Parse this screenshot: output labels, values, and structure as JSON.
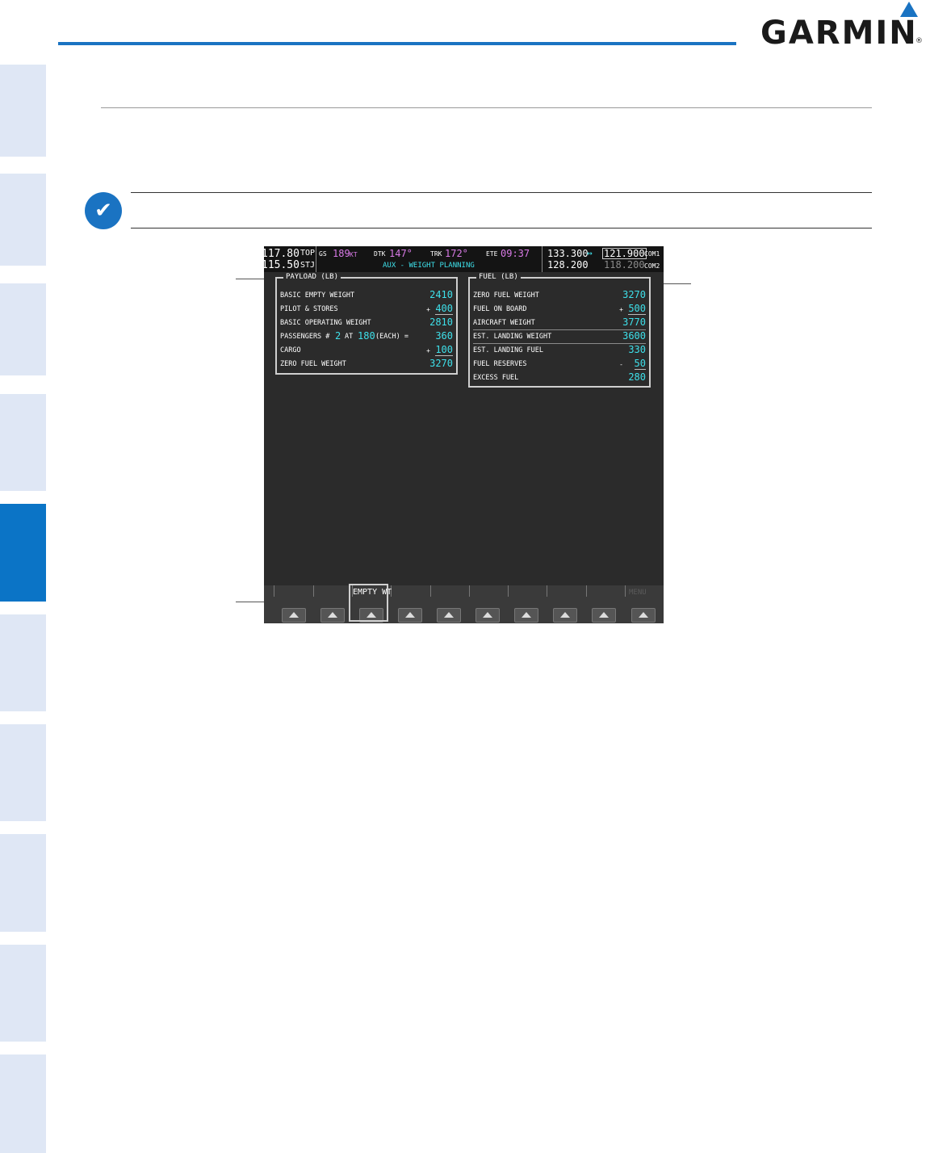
{
  "header": {
    "brand": "GARMIN",
    "registered": "®"
  },
  "note": {
    "icon": "checkmark-icon"
  },
  "display": {
    "topbar": {
      "nav1_active": "117.80",
      "nav1_standby": "115.50",
      "top_label": "TOP",
      "stj_label": "STJ",
      "gs_label": "GS",
      "gs_value": "189",
      "gs_unit": "KT",
      "dtk_label": "DTK",
      "dtk_value": "147°",
      "trk_label": "TRK",
      "trk_value": "172°",
      "ete_label": "ETE",
      "ete_value": "09:37",
      "page_title": "AUX - WEIGHT PLANNING",
      "com1_active": "133.300",
      "com1_swap": "↔",
      "com1_standby": "121.900",
      "com1_label": "COM1",
      "com2_active": "128.200",
      "com2_standby": "118.200",
      "com2_label": "COM2"
    },
    "payload": {
      "title": "PAYLOAD (LB)",
      "rows": [
        {
          "label": "BASIC EMPTY WEIGHT",
          "value": "2410"
        },
        {
          "label": "PILOT & STORES",
          "op": "+",
          "value": "400"
        },
        {
          "label": "BASIC OPERATING WEIGHT",
          "value": "2810"
        },
        {
          "label": "PASSENGERS #",
          "pax_count": "2",
          "at_label": "AT",
          "pax_weight": "180",
          "each_label": "(EACH) =",
          "value": "360"
        },
        {
          "label": "CARGO",
          "op": "+",
          "value": "100"
        },
        {
          "label": "ZERO FUEL WEIGHT",
          "value": "3270"
        }
      ]
    },
    "fuel": {
      "title": "FUEL (LB)",
      "rows": [
        {
          "label": "ZERO FUEL WEIGHT",
          "value": "3270"
        },
        {
          "label": "FUEL ON BOARD",
          "op": "+",
          "value": "500"
        },
        {
          "label": "AIRCRAFT WEIGHT",
          "value": "3770"
        },
        {
          "label": "EST. LANDING WEIGHT",
          "value": "3600"
        },
        {
          "label": "EST. LANDING FUEL",
          "value": "330"
        },
        {
          "label": "FUEL RESERVES",
          "op": "-",
          "value": "50"
        },
        {
          "label": "EXCESS FUEL",
          "value": "280"
        }
      ]
    },
    "softkeys": {
      "highlighted_label": "EMPTY WT",
      "faded_label": "MENU"
    }
  }
}
